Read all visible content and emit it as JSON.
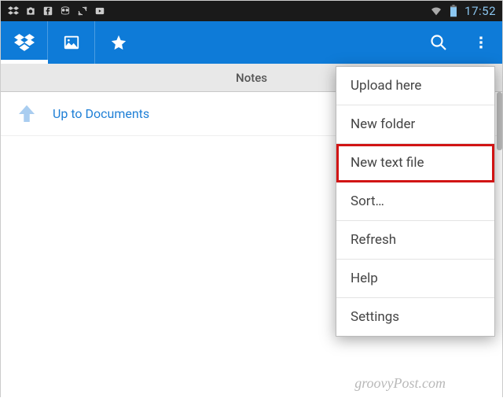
{
  "status_bar": {
    "time": "17:52"
  },
  "folder_header": "Notes",
  "up_nav": {
    "label": "Up to Documents"
  },
  "menu": {
    "items": [
      {
        "label": "Upload here"
      },
      {
        "label": "New folder"
      },
      {
        "label": "New text file",
        "highlighted": true
      },
      {
        "label": "Sort…"
      },
      {
        "label": "Refresh"
      },
      {
        "label": "Help"
      },
      {
        "label": "Settings"
      }
    ]
  },
  "watermark": "groovyPost.com",
  "colors": {
    "action_bar": "#0e7bd8",
    "highlight_outline": "#d11414",
    "link": "#1e7fd6"
  }
}
